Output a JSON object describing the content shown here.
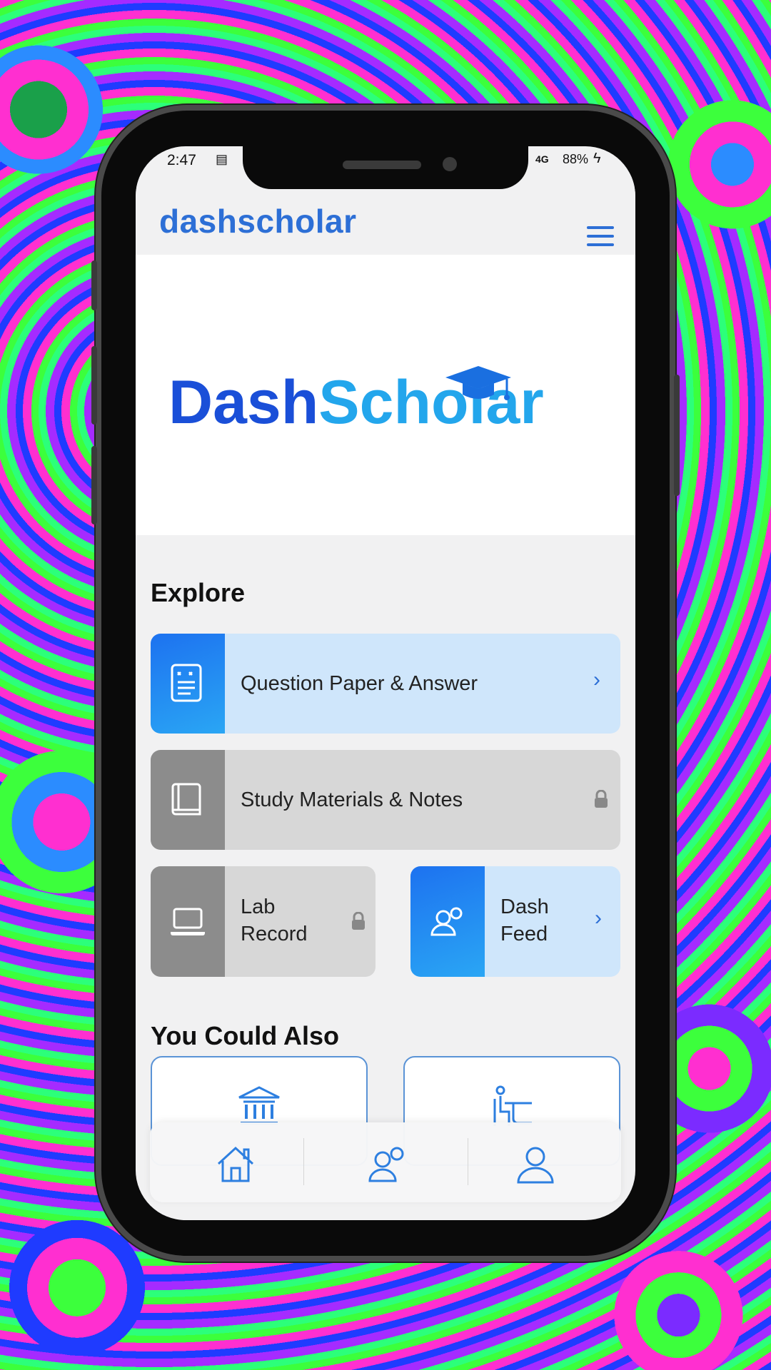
{
  "status_bar": {
    "time": "2:47",
    "network": "4G",
    "battery": "88%"
  },
  "app_bar": {
    "brand": "dashscholar",
    "menu_icon": "hamburger-menu-icon"
  },
  "hero": {
    "logo_part1": "Dash",
    "logo_part2": "Scholar",
    "logo_icon": "graduation-cap-icon"
  },
  "explore": {
    "title": "Explore",
    "items": [
      {
        "label": "Question Paper & Answer",
        "icon": "question-paper-icon",
        "state": "open"
      },
      {
        "label": "Study Materials & Notes",
        "icon": "book-icon",
        "state": "locked"
      },
      {
        "label_line1": "Lab",
        "label_line2": "Record",
        "icon": "laptop-icon",
        "state": "locked"
      },
      {
        "label_line1": "Dash",
        "label_line2": "Feed",
        "icon": "user-feed-icon",
        "state": "open"
      }
    ]
  },
  "also": {
    "title": "You Could Also",
    "items": [
      {
        "icon": "college-building-icon"
      },
      {
        "icon": "desk-study-icon"
      }
    ]
  },
  "bottom_nav": {
    "items": [
      {
        "icon": "home-icon"
      },
      {
        "icon": "feed-icon"
      },
      {
        "icon": "profile-icon"
      }
    ]
  },
  "colors": {
    "brand_blue": "#2d6fd6",
    "card_blue": "#cfe6fb",
    "card_grey": "#d7d7d7"
  }
}
